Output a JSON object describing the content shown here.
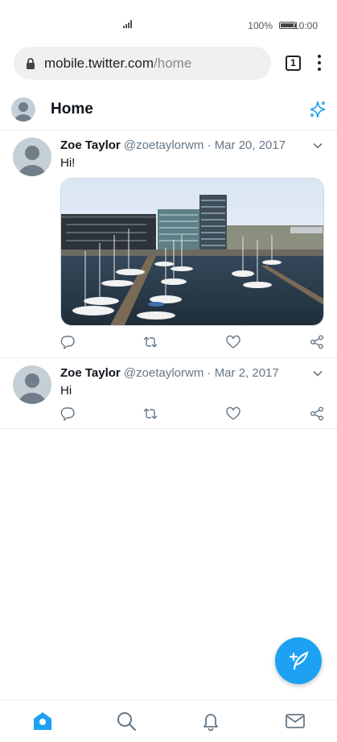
{
  "status_bar": {
    "battery_percent": "100%",
    "time": "10:00",
    "icons": [
      "signal-icon",
      "battery-icon"
    ]
  },
  "browser": {
    "url_host": "mobile.twitter.com",
    "url_path": "/home",
    "tab_count": "1",
    "icons": [
      "lock-icon",
      "tabs-icon",
      "overflow-menu-icon"
    ]
  },
  "header": {
    "title": "Home",
    "icons": [
      "profile-avatar",
      "sparkle-icon"
    ]
  },
  "tweets": [
    {
      "name": "Zoe Taylor",
      "handle": "@zoetaylorwm",
      "separator": "·",
      "date": "Mar 20, 2017",
      "text": "Hi!",
      "has_media": true,
      "media_description_icon": "harbor-photo"
    },
    {
      "name": "Zoe Taylor",
      "handle": "@zoetaylorwm",
      "separator": "·",
      "date": "Mar 2, 2017",
      "text": "Hi",
      "has_media": false
    }
  ],
  "tweet_actions": [
    "reply-icon",
    "retweet-icon",
    "like-icon",
    "share-icon"
  ],
  "fab": {
    "icon": "compose-tweet-icon"
  },
  "bottom_nav": {
    "items": [
      "home-icon",
      "search-icon",
      "notifications-icon",
      "messages-icon"
    ],
    "active": "home-icon"
  },
  "colors": {
    "accent": "#1da1f2",
    "text_primary": "#0f1419",
    "text_secondary": "#657786",
    "divider": "#e6ecf0",
    "url_bar": "#f0f0f0"
  }
}
